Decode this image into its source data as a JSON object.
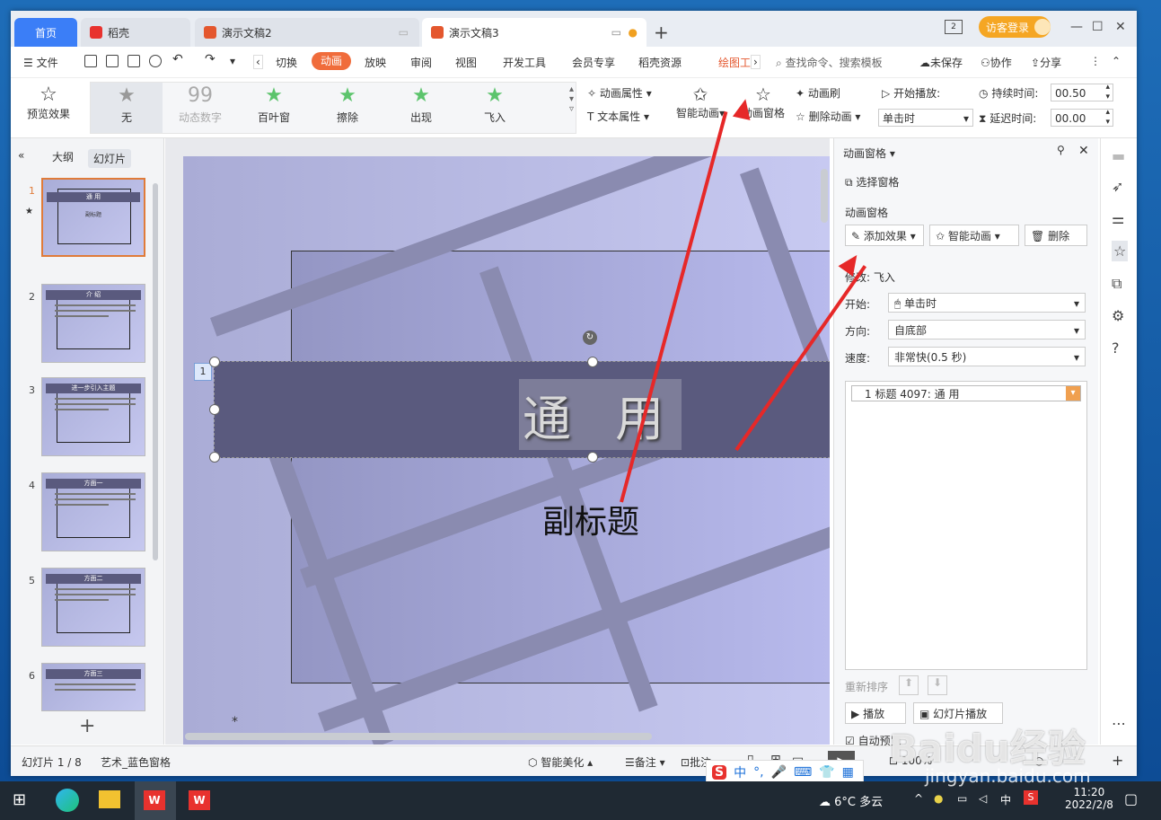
{
  "tabs": {
    "home": "首页",
    "tab1": "稻壳",
    "tab2": "演示文稿2",
    "tab3": "演示文稿3",
    "login": "访客登录"
  },
  "menu": {
    "file": "文件",
    "items": [
      "切换",
      "动画",
      "放映",
      "审阅",
      "视图",
      "开发工具",
      "会员专享",
      "稻壳资源",
      "绘图工"
    ],
    "search": "查找命令、搜索模板",
    "unsaved": "未保存",
    "collab": "协作",
    "share": "分享"
  },
  "ribbon": {
    "preview": "预览效果",
    "effects": [
      "无",
      "动态数字",
      "百叶窗",
      "擦除",
      "出现",
      "飞入"
    ],
    "anim_attr": "动画属性",
    "text_attr": "文本属性",
    "smart_anim": "智能动画",
    "anim_pane": "动画窗格",
    "anim_brush": "动画刷",
    "delete_anim": "删除动画",
    "start_play": "开始播放:",
    "start_value": "单击时",
    "duration_label": "持续时间:",
    "duration_value": "00.50",
    "delay_label": "延迟时间:",
    "delay_value": "00.00"
  },
  "left": {
    "outline": "大纲",
    "slides": "幻灯片",
    "thumbs": [
      {
        "num": "1",
        "title": "通 用",
        "sub": "副标题"
      },
      {
        "num": "2",
        "title": "介 绍",
        "sub": ""
      },
      {
        "num": "3",
        "title": "进一步引入主题",
        "sub": ""
      },
      {
        "num": "4",
        "title": "方面一",
        "sub": ""
      },
      {
        "num": "5",
        "title": "方面二",
        "sub": ""
      },
      {
        "num": "6",
        "title": "方面三",
        "sub": ""
      }
    ]
  },
  "slide": {
    "title": "通 用",
    "subtitle": "副标题",
    "anim_tag": "1"
  },
  "right": {
    "header": "动画窗格",
    "select_pane": "选择窗格",
    "section": "动画窗格",
    "add_effect": "添加效果",
    "smart_anim": "智能动画",
    "delete": "删除",
    "modify": "修改: 飞入",
    "start_label": "开始:",
    "start_value": "单击时",
    "dir_label": "方向:",
    "dir_value": "自底部",
    "speed_label": "速度:",
    "speed_value": "非常快(0.5 秒)",
    "item": "1    标题 4097: 通  用",
    "reorder": "重新排序",
    "play": "播放",
    "slideshow": "幻灯片播放",
    "autopreview": "自动预览"
  },
  "status": {
    "slide_count": "幻灯片 1 / 8",
    "theme": "艺术_蓝色窗格",
    "beautify": "智能美化",
    "notes": "备注",
    "comments": "批注",
    "zoom": "100%"
  },
  "taskbar": {
    "weather": "6°C  多云",
    "ime": "中",
    "time": "11:20",
    "date": "2022/2/8"
  },
  "watermark": {
    "brand": "Baidu经验",
    "url": "jingyan.baidu.com"
  }
}
